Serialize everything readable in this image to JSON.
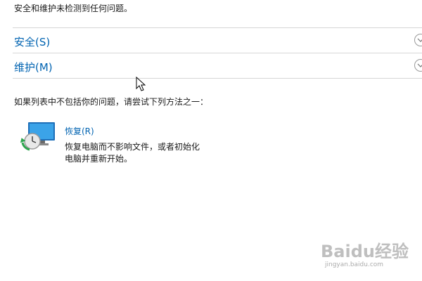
{
  "intro_text": "安全和维护未检测到任何问题。",
  "sections": [
    {
      "title": "安全(S)"
    },
    {
      "title": "维护(M)"
    }
  ],
  "hint_text": "如果列表中不包括你的问题，请尝试下列方法之一：",
  "options": [
    {
      "link_label": "恢复(R)",
      "description": "恢复电脑而不影响文件，或者初始化电脑并重新开始。",
      "icon": "recovery-computer-icon"
    }
  ],
  "watermark": {
    "logo": "Baidu经验",
    "url": "jingyan.baidu.com"
  },
  "colors": {
    "link": "#0063b1",
    "divider": "#d6d6d6",
    "text": "#1a1a1a"
  }
}
